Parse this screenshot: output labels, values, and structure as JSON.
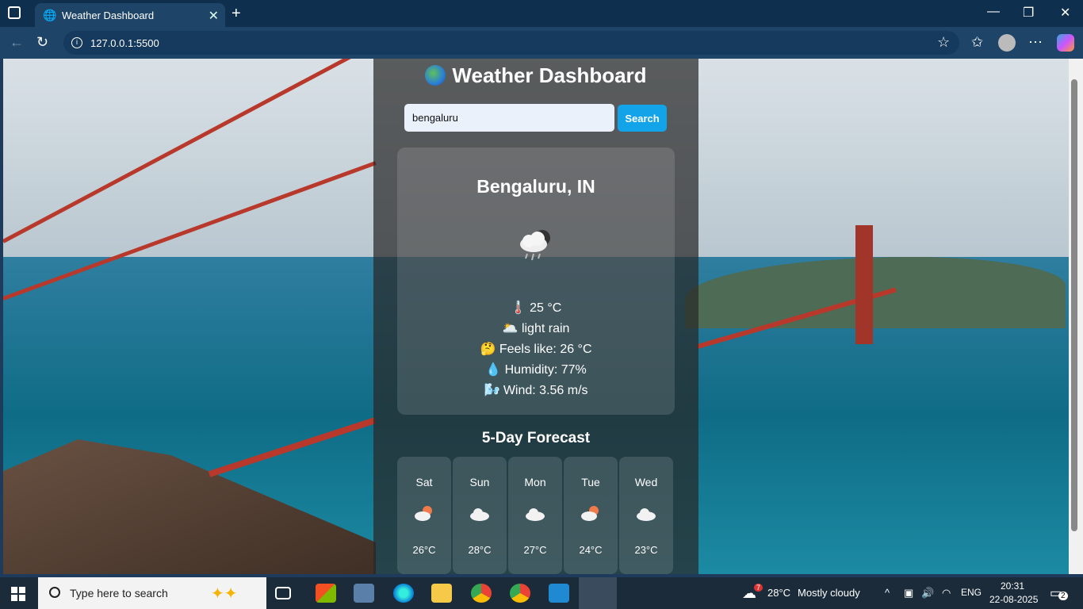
{
  "browser": {
    "tab_title": "Weather Dashboard",
    "url": "127.0.0.1:5500"
  },
  "app": {
    "title": "Weather Dashboard",
    "search": {
      "value": "bengaluru",
      "button_label": "Search"
    },
    "current": {
      "city": "Bengaluru, IN",
      "temp": "25 °C",
      "description": "light rain",
      "feels_like": "Feels like: 26 °C",
      "humidity": "Humidity: 77%",
      "wind": "Wind: 3.56 m/s",
      "icons": {
        "weather": "cloud-rain-icon",
        "temp": "thermometer-icon",
        "description": "cloud-icon",
        "feels_like": "thinking-face-icon",
        "humidity": "droplet-icon",
        "wind": "wind-icon"
      }
    },
    "forecast_title": "5-Day Forecast",
    "forecast": [
      {
        "day": "Sat",
        "temp": "26°C",
        "icon": "cloud-sun-icon"
      },
      {
        "day": "Sun",
        "temp": "28°C",
        "icon": "cloud-icon"
      },
      {
        "day": "Mon",
        "temp": "27°C",
        "icon": "cloud-icon"
      },
      {
        "day": "Tue",
        "temp": "24°C",
        "icon": "cloud-sun-icon"
      },
      {
        "day": "Wed",
        "temp": "23°C",
        "icon": "cloud-icon"
      }
    ]
  },
  "taskbar": {
    "search_placeholder": "Type here to search",
    "weather": "28°C",
    "weather_desc": "Mostly cloudy",
    "weather_badge": "7",
    "lang": "ENG",
    "time": "20:31",
    "date": "22-08-2025",
    "notifications": "2"
  },
  "colors": {
    "search_button": "#13a3e8",
    "panel_bg": "rgba(40,40,40,0.72)"
  }
}
